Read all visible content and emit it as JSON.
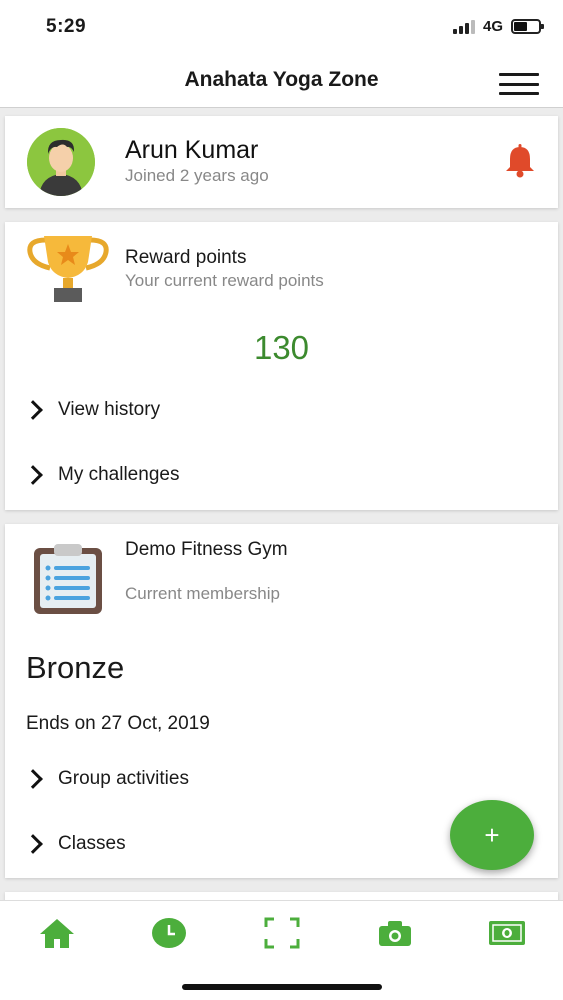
{
  "status_bar": {
    "time": "5:29",
    "network": "4G"
  },
  "header": {
    "title": "Anahata Yoga Zone",
    "menu_icon": "hamburger-menu-icon"
  },
  "profile": {
    "name": "Arun Kumar",
    "joined": "Joined 2 years ago",
    "notification_icon": "bell-icon",
    "notification_color": "#e04a2a"
  },
  "rewards": {
    "title": "Reward points",
    "subtitle": "Your current reward points",
    "points": "130",
    "points_color": "#3c8a2e",
    "links": [
      {
        "label": "View history"
      },
      {
        "label": "My challenges"
      }
    ]
  },
  "membership": {
    "gym": "Demo Fitness Gym",
    "label": "Current membership",
    "tier": "Bronze",
    "ends": "Ends on 27 Oct, 2019",
    "links": [
      {
        "label": "Group activities"
      },
      {
        "label": "Classes"
      }
    ]
  },
  "fab": {
    "label": "+",
    "color": "#4cae3c"
  },
  "bottom_nav": {
    "accent": "#4cae3c",
    "items": [
      {
        "icon": "home-icon"
      },
      {
        "icon": "clock-icon"
      },
      {
        "icon": "scan-icon"
      },
      {
        "icon": "camera-icon"
      },
      {
        "icon": "cash-icon"
      }
    ]
  }
}
